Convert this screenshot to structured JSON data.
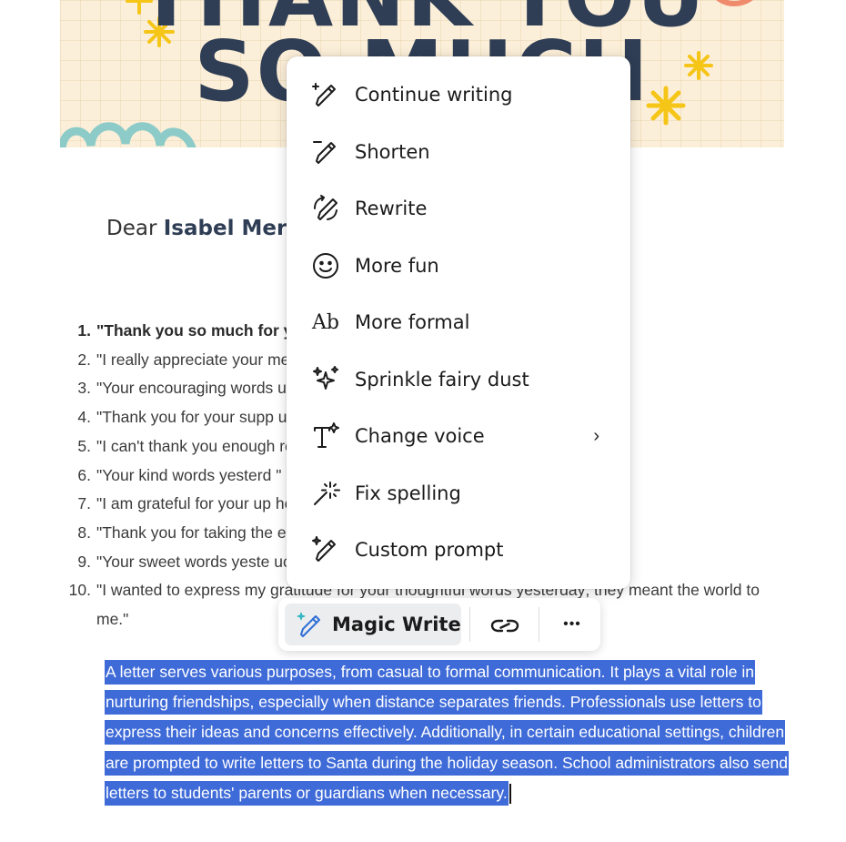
{
  "banner": {
    "title": "THANK YOU\nSO MUCH",
    "colors": {
      "background": "#fcefd9",
      "title": "#2f3e55",
      "star": "#f5c518",
      "squiggle": "#8dcbc8",
      "accent": "#f08a6c"
    }
  },
  "letter": {
    "greeting_prefix": "Dear",
    "recipient": "Isabel Merc",
    "items": [
      {
        "num": "1.",
        "text": "\"Thank you so much for y                                                           hed my day.\""
      },
      {
        "num": "2.",
        "text": "\"I really appreciate your                                                              meant a lot to me.\""
      },
      {
        "num": "3.",
        "text": "\"Your encouraging words                                                               u!\""
      },
      {
        "num": "4.",
        "text": "\"Thank you for your supp                                                             uch-needed boost.\""
      },
      {
        "num": "5.",
        "text": "\"I can't thank you enough                                                             re very comforting.\""
      },
      {
        "num": "6.",
        "text": "\"Your kind words yesterd                                                              \""
      },
      {
        "num": "7.",
        "text": "\"I am grateful for your up                                                             heartwarming.\""
      },
      {
        "num": "8.",
        "text": "\"Thank you for taking the                                                             erday.\""
      },
      {
        "num": "9.",
        "text": "\"Your sweet words yeste                                                              uch.\""
      },
      {
        "num": "10.",
        "text": "\"I wanted to express my gratitude for your thoughtful words yesterday; they meant the world to me.\""
      }
    ],
    "selected_paragraph": "A letter serves various purposes, from casual to formal communication. It plays a vital role in nurturing friendships, especially when distance separates friends. Professionals use letters to express their ideas and concerns effectively. Additionally, in certain educational settings, children are prompted to write letters to Santa during the holiday season. School administrators also send letters to students' parents or guardians when necessary.",
    "selection_color": "#3f6bd8"
  },
  "menu": {
    "items": [
      {
        "label": "Continue writing",
        "icon": "pencil-plus-icon"
      },
      {
        "label": "Shorten",
        "icon": "pencil-lines-icon"
      },
      {
        "label": "Rewrite",
        "icon": "rewrite-icon"
      },
      {
        "label": "More fun",
        "icon": "smiley-icon"
      },
      {
        "label": "More formal",
        "icon": "ab-text-icon"
      },
      {
        "label": "Sprinkle fairy dust",
        "icon": "sparkles-icon"
      },
      {
        "label": "Change voice",
        "icon": "text-sparkle-icon",
        "has_submenu": true
      },
      {
        "label": "Fix spelling",
        "icon": "magic-wand-icon"
      },
      {
        "label": "Custom prompt",
        "icon": "pencil-sparkle-icon"
      }
    ],
    "submenu_chevron": "›"
  },
  "toolbar": {
    "magic_write_label": "Magic Write",
    "magic_write_icon": "magic-pencil-icon",
    "link_icon": "link-icon",
    "more_icon": "more-horizontal-icon",
    "more_glyph": "•••"
  }
}
